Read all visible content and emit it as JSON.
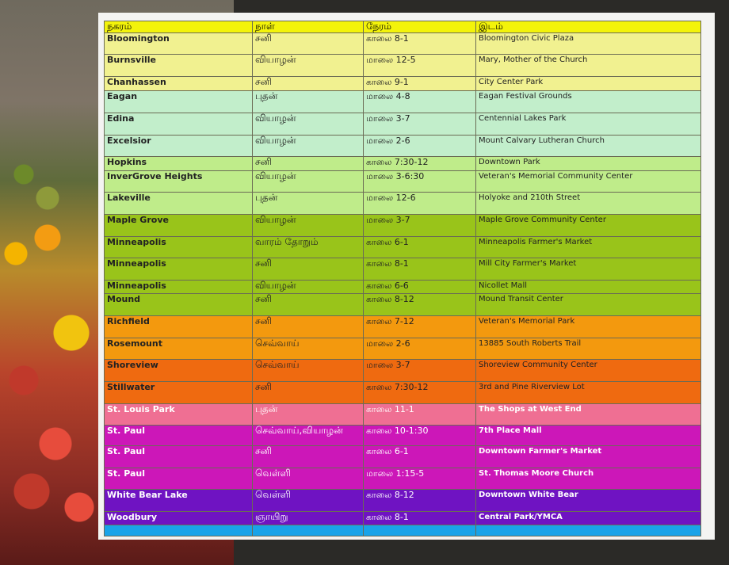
{
  "headers": [
    "நகரம்",
    "நாள்",
    "நேரம்",
    "இடம்"
  ],
  "rows": [
    {
      "city": "Bloomington",
      "day": "சனி",
      "time": "காலை  8-1",
      "place": "Bloomington Civic Plaza",
      "bg": "#f1f190",
      "h": 27
    },
    {
      "city": "Burnsville",
      "day": "வியாழன்",
      "time": "மாலை  12-5",
      "place": "Mary, Mother of the Church",
      "bg": "#f1f190",
      "h": 28
    },
    {
      "city": "Chanhassen",
      "day": "சனி",
      "time": "காலை  9-1",
      "place": "City Center Park",
      "bg": "#f1f190",
      "h": 18
    },
    {
      "city": "Eagan",
      "day": "புதன்",
      "time": "மாலை  4-8",
      "place": "Eagan Festival Grounds",
      "bg": "#c2eecb",
      "h": 28
    },
    {
      "city": "Edina",
      "day": "வியாழன்",
      "time": "மாலை  3-7",
      "place": "Centennial Lakes Park",
      "bg": "#c2eecb",
      "h": 28
    },
    {
      "city": "Excelsior",
      "day": "வியாழன்",
      "time": "மாலை  2-6",
      "place": "Mount Calvary Lutheran Church",
      "bg": "#c2eecb",
      "h": 27
    },
    {
      "city": "Hopkins",
      "day": "சனி",
      "time": "காலை  7:30-12",
      "place": "Downtown Park",
      "bg": "#bfec8a",
      "h": 18
    },
    {
      "city": "InverGrove Heights",
      "day": "வியாழன்",
      "time": "மாலை  3-6:30",
      "place": "Veteran's Memorial Community Center",
      "bg": "#bfec8a",
      "h": 27
    },
    {
      "city": "Lakeville",
      "day": "புதன்",
      "time": "மாலை  12-6",
      "place": "Holyoke and 210th Street",
      "bg": "#bfec8a",
      "h": 28
    },
    {
      "city": "Maple Grove",
      "day": "வியாழன்",
      "time": "மாலை  3-7",
      "place": "Maple Grove Community Center",
      "bg": "#99c41a",
      "h": 28
    },
    {
      "city": "Minneapolis",
      "day": "வாரம் தோறும்",
      "time": "காலை  6-1",
      "place": "Minneapolis Farmer's Market",
      "bg": "#99c41a",
      "h": 27
    },
    {
      "city": "Minneapolis",
      "day": "சனி",
      "time": "காலை  8-1",
      "place": "Mill City Farmer's Market",
      "bg": "#99c41a",
      "h": 28
    },
    {
      "city": "Minneapolis",
      "day": "வியாழன்",
      "time": "காலை  6-6",
      "place": "Nicollet Mall",
      "bg": "#99c41a",
      "h": 17
    },
    {
      "city": "Mound",
      "day": "சனி",
      "time": "காலை  8-12",
      "place": "Mound Transit Center",
      "bg": "#99c41a",
      "h": 28
    },
    {
      "city": "Richfield",
      "day": "சனி",
      "time": "காலை  7-12",
      "place": "Veteran's Memorial Park",
      "bg": "#f3990e",
      "h": 28
    },
    {
      "city": "Rosemount",
      "day": "செவ்வாய்",
      "time": "மாலை  2-6",
      "place": "13885 South Roberts Trail",
      "bg": "#f3990e",
      "h": 27
    },
    {
      "city": "Shoreview",
      "day": "செவ்வாய்",
      "time": "மாலை  3-7",
      "place": "Shoreview Community Center",
      "bg": "#ef6a10",
      "h": 28
    },
    {
      "city": "Stillwater",
      "day": "சனி",
      "time": "காலை  7:30-12",
      "place": "3rd and Pine Riverview Lot",
      "bg": "#ef6a10",
      "h": 28
    },
    {
      "city": "St. Louis Park",
      "day": "புதன்",
      "time": "காலை  11-1",
      "place": "The Shops at West End",
      "bg": "#ef6f93",
      "h": 27
    },
    {
      "city": "St. Paul",
      "day": "செவ்வாய்,வியாழன்",
      "time": "காலை  10-1:30",
      "place": "7th Place Mall",
      "bg": "#cc17b8",
      "h": 26
    },
    {
      "city": "St. Paul",
      "day": "சனி",
      "time": "காலை  6-1",
      "place": "Downtown Farmer's Market",
      "bg": "#cc17b8",
      "h": 28
    },
    {
      "city": "St. Paul",
      "day": "வெள்ளி",
      "time": "மாலை  1:15-5",
      "place": "St. Thomas Moore Church",
      "bg": "#cc17b8",
      "h": 27
    },
    {
      "city": "White Bear Lake",
      "day": "வெள்ளி",
      "time": "காலை  8-12",
      "place": "Downtown White Bear",
      "bg": "#6f13c2",
      "h": 28
    },
    {
      "city": "Woodbury",
      "day": "ஞாயிறு",
      "time": "காலை  8-1",
      "place": "Central Park/YMCA",
      "bg": "#6f13c2",
      "h": 17
    },
    {
      "city": "",
      "day": "",
      "time": "",
      "place": "",
      "bg": "#19a3e8",
      "h": 14
    }
  ],
  "colors": {
    "header": "#f3f30a",
    "board": "#f4f4f2",
    "background": "#2b2a27"
  }
}
